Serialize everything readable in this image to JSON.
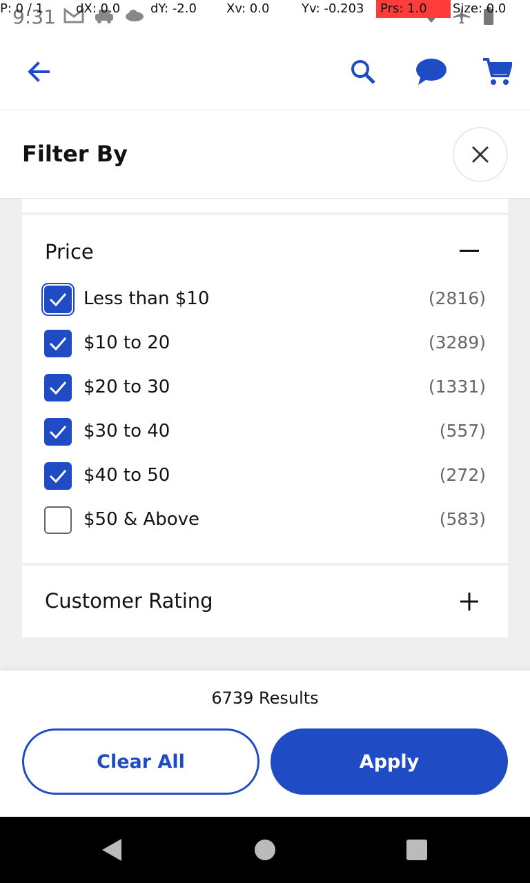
{
  "status_bar": {
    "time": "9:31",
    "debug": {
      "p": "P: 0 / 1",
      "dx": "dX: 0.0",
      "dy": "dY: -2.0",
      "xv": "Xv: 0.0",
      "yv": "Yv: -0.203",
      "prs": "Prs: 1.0",
      "size": "Size: 0.0"
    },
    "icons": [
      "gmail-icon",
      "car-icon",
      "cloud-icon",
      "wifi-icon",
      "airplane-icon",
      "battery-icon"
    ]
  },
  "app_bar": {
    "icons": [
      "back-arrow-icon",
      "search-icon",
      "chat-icon",
      "cart-icon"
    ],
    "accent": "#1f4bc4"
  },
  "filter": {
    "title": "Filter By",
    "price": {
      "title": "Price",
      "options": [
        {
          "label": "Less than $10",
          "count": "(2816)",
          "checked": true
        },
        {
          "label": "$10 to 20",
          "count": "(3289)",
          "checked": true
        },
        {
          "label": "$20 to 30",
          "count": "(1331)",
          "checked": true
        },
        {
          "label": "$30 to 40",
          "count": "(557)",
          "checked": true
        },
        {
          "label": "$40 to 50",
          "count": "(272)",
          "checked": true
        },
        {
          "label": "$50 & Above",
          "count": "(583)",
          "checked": false
        }
      ]
    },
    "customer_rating": {
      "title": "Customer Rating"
    }
  },
  "footer": {
    "results": "6739 Results",
    "clear_all_label": "Clear All",
    "apply_label": "Apply"
  }
}
